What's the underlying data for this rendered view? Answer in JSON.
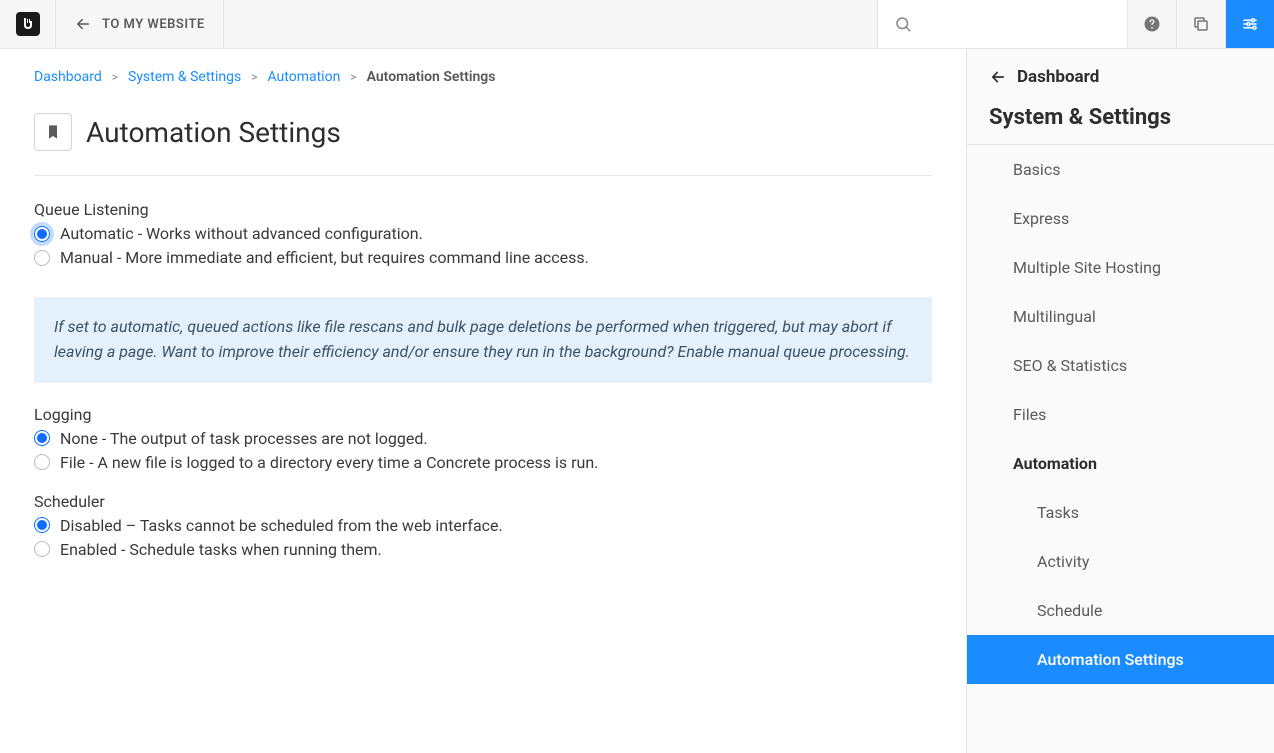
{
  "topbar": {
    "back_label": "TO MY WEBSITE"
  },
  "breadcrumb": {
    "items": [
      "Dashboard",
      "System & Settings",
      "Automation"
    ],
    "current": "Automation Settings"
  },
  "page": {
    "title": "Automation Settings"
  },
  "queue": {
    "label": "Queue Listening",
    "option_auto": "Automatic - Works without advanced configuration.",
    "option_manual": "Manual - More immediate and efficient, but requires command line access.",
    "info": "If set to automatic, queued actions like file rescans and bulk page deletions be performed when triggered, but may abort if leaving a page. Want to improve their efficiency and/or ensure they run in the background? Enable manual queue processing."
  },
  "logging": {
    "label": "Logging",
    "option_none": "None - The output of task processes are not logged.",
    "option_file": "File - A new file is logged to a directory every time a Concrete process is run."
  },
  "scheduler": {
    "label": "Scheduler",
    "option_disabled": "Disabled – Tasks cannot be scheduled from the web interface.",
    "option_enabled": "Enabled - Schedule tasks when running them."
  },
  "sidebar": {
    "back_label": "Dashboard",
    "title": "System & Settings",
    "items": [
      {
        "label": "Basics"
      },
      {
        "label": "Express"
      },
      {
        "label": "Multiple Site Hosting"
      },
      {
        "label": "Multilingual"
      },
      {
        "label": "SEO & Statistics"
      },
      {
        "label": "Files"
      },
      {
        "label": "Automation",
        "bold": true
      }
    ],
    "subitems": [
      {
        "label": "Tasks"
      },
      {
        "label": "Activity"
      },
      {
        "label": "Schedule"
      },
      {
        "label": "Automation Settings",
        "active": true
      }
    ]
  }
}
